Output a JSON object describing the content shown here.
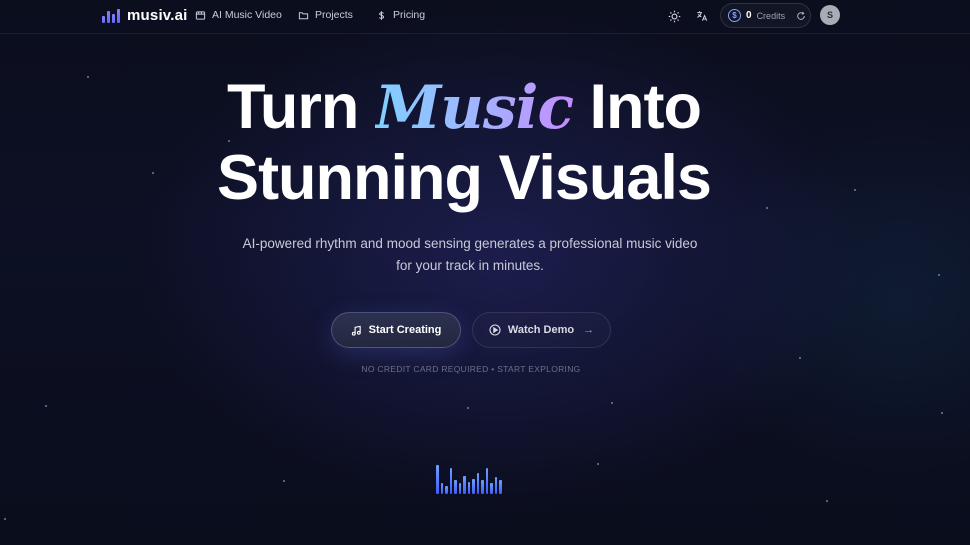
{
  "nav": {
    "logo_text": "musiv.ai",
    "links": [
      {
        "label": "AI Music Video",
        "icon": "video-icon"
      },
      {
        "label": "Projects",
        "icon": "folder-icon"
      },
      {
        "label": "Pricing",
        "icon": "dollar-icon"
      }
    ],
    "theme_icon": "sun-icon",
    "language_icon": "translate-icon",
    "credits": {
      "count": "0",
      "label": "Credits",
      "coin_icon": "dollar-coin-icon",
      "refresh_icon": "refresh-icon"
    },
    "avatar_initial": "S"
  },
  "hero": {
    "title_pre": "Turn",
    "title_accent": "Music",
    "title_post": "Into",
    "title_line2": "Stunning Visuals",
    "subtitle": "AI-powered rhythm and mood sensing generates a professional music video for your track in minutes.",
    "primary_button": "Start Creating",
    "secondary_button": "Watch Demo",
    "note": "NO CREDIT CARD REQUIRED • START EXPLORING"
  },
  "colors": {
    "background": "#0b0e1d",
    "accent_gradient_start": "#7fd0ff",
    "accent_gradient_end": "#c48dff",
    "eq_bar": "#4f75ff"
  },
  "equalizer_levels": [
    0.95,
    0.35,
    0.25,
    0.85,
    0.45,
    0.35,
    0.6,
    0.4,
    0.5,
    0.7,
    0.45,
    0.85,
    0.35,
    0.55,
    0.45
  ]
}
